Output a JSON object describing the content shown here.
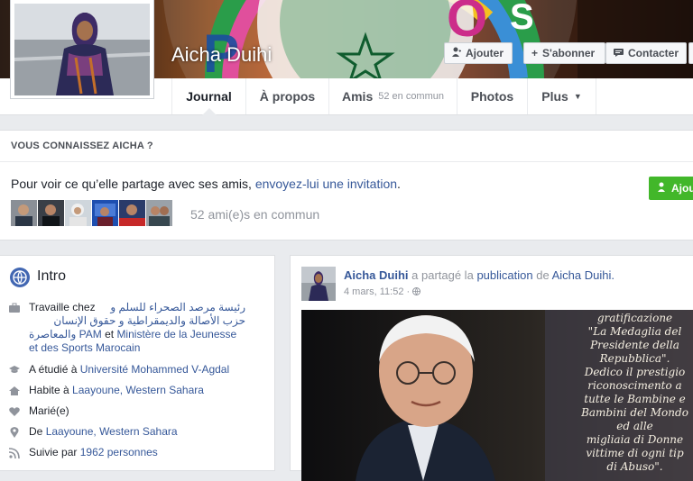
{
  "profile": {
    "name": "Aicha Duihi",
    "actions": {
      "add": "Ajouter",
      "follow": "S'abonner",
      "contact": "Contacter"
    }
  },
  "nav": {
    "tabs": [
      {
        "label": "Journal"
      },
      {
        "label": "À propos"
      },
      {
        "label": "Amis",
        "sub": "52 en commun"
      },
      {
        "label": "Photos"
      },
      {
        "label": "Plus"
      }
    ]
  },
  "know": {
    "title": "VOUS CONNAISSEZ AICHA ?",
    "text_before": "Pour voir ce qu’elle partage avec ses amis,",
    "link": "envoyez-lui une invitation",
    "text_after": ".",
    "add_button": "Ajou",
    "mutual": "52 ami(e)s en commun"
  },
  "intro": {
    "title": "Intro",
    "work": {
      "prefix": "Travaille chez",
      "arabic_line1": "رئيسة مرصد الصحراء للسلم و",
      "arabic_line2": "حزب الأصالة والديمقراطية و حقوق الإنسان",
      "arabic_line3": "PAM والمعاصرة",
      "and": "et",
      "org2": "Ministère de la Jeunesse et des Sports Marocain"
    },
    "studied": {
      "prefix": "A étudié à",
      "link": "Université Mohammed V-Agdal"
    },
    "lives": {
      "prefix": "Habite à",
      "link": "Laayoune, Western Sahara"
    },
    "relationship": "Marié(e)",
    "from": {
      "prefix": "De",
      "link": "Laayoune, Western Sahara"
    },
    "followers": {
      "prefix": "Suivie par",
      "link": "1962 personnes"
    }
  },
  "post": {
    "author": "Aicha Duihi",
    "shared": "a partagé la",
    "publication": "publication",
    "de": "de",
    "source": "Aicha Duihi.",
    "time": "4 mars, 11:52 ·",
    "image_text": [
      "gratificazione",
      "\"La Medaglia del",
      "Presidente della",
      "Repubblica\".",
      "Dedico il prestigio",
      "riconoscimento a",
      "tutte le Bambine e",
      "Bambini del Mondo",
      "ed alle",
      "migliaia di Donne",
      "vittime di ogni tip",
      "di Abuso\"."
    ]
  },
  "colors": {
    "link": "#365899",
    "green": "#42b72a",
    "bg": "#e9ebee"
  },
  "icons": {
    "add": "add-friend-icon",
    "follow": "plus-icon",
    "contact": "message-icon",
    "intro": "globe-icon",
    "work": "briefcase-icon",
    "study": "graduation-cap-icon",
    "home": "house-icon",
    "relationship": "heart-icon",
    "from": "location-pin-icon",
    "followers": "rss-icon",
    "privacy": "globe-icon"
  }
}
